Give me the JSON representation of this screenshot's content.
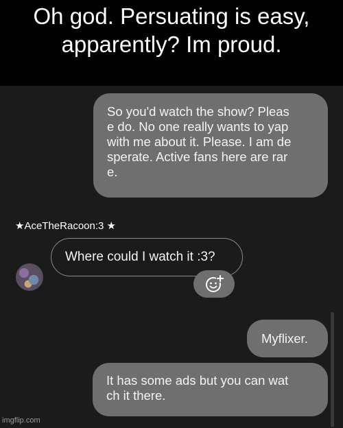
{
  "meme": {
    "caption": "Oh god. Persuating is easy, apparently? Im proud.",
    "watermark": "imgflip.com"
  },
  "chat": {
    "messages": [
      {
        "direction": "sent",
        "text": "So you'd watch the show? Pleas\ne do. No one really wants to yap\nwith me about it. Please. I am de\nsperate. Active fans here are rar\ne."
      },
      {
        "direction": "received",
        "sender": "★AceTheRacoon:3 ★",
        "text": "Where could I watch it :3?"
      },
      {
        "direction": "sent",
        "text": "Myflixer."
      },
      {
        "direction": "sent",
        "text": "It has some ads but you can wat\nch it there."
      }
    ],
    "reaction_icon": "add-reaction-icon",
    "colors": {
      "background": "#1b1b1b",
      "sent_bubble": "#6f6f6f",
      "received_border": "#8a8a8a",
      "text": "#f4f4f4"
    }
  }
}
